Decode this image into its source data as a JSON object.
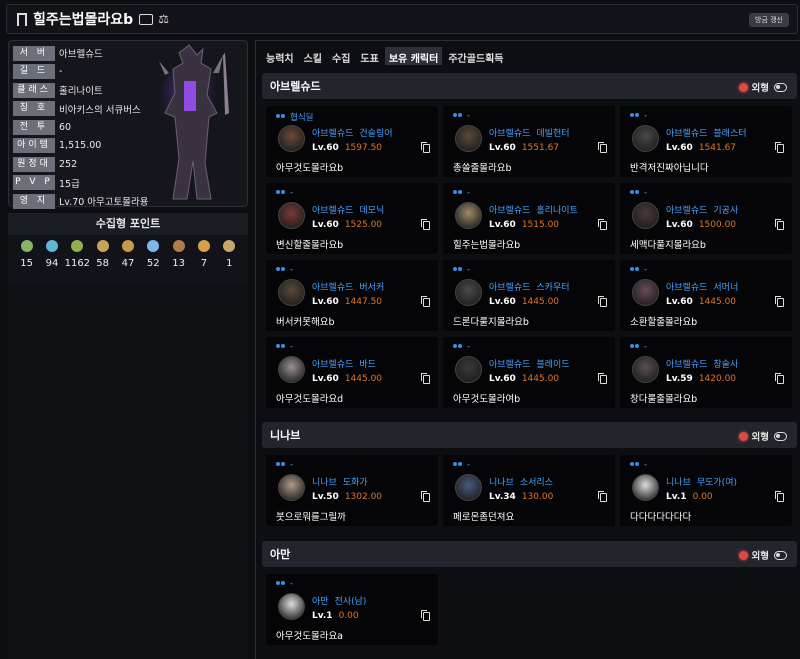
{
  "header": {
    "name": "힐주는법몰라요b",
    "refresh_label": "방금 갱신"
  },
  "profile": {
    "rows": [
      {
        "label": "서 버",
        "value": "아브렐슈드"
      },
      {
        "label": "길 드",
        "value": "-"
      },
      {
        "label": "클래스",
        "value": "홀리나이트"
      },
      {
        "label": "칭 호",
        "value": "비아키스의 서큐버스"
      },
      {
        "label": "전 투",
        "value": "60"
      },
      {
        "label": "아이템",
        "value": "1,515.00"
      },
      {
        "label": "원정대",
        "value": "252"
      },
      {
        "label": "P V P",
        "value": "15급"
      },
      {
        "label": "영 지",
        "value": "Lv.70 아무고토몰라용"
      }
    ]
  },
  "collect": {
    "title": "수집형 포인트",
    "items": [
      {
        "icon": "mokoko-seed-icon",
        "value": "15",
        "color": "#8ab36a"
      },
      {
        "icon": "island-heart-icon",
        "value": "94",
        "color": "#5fb6d6"
      },
      {
        "icon": "giant-heart-icon",
        "value": "1162",
        "color": "#8fb04a"
      },
      {
        "icon": "great-artwork-icon",
        "value": "58",
        "color": "#c7a35a"
      },
      {
        "icon": "voyage-icon",
        "value": "47",
        "color": "#c79a4a"
      },
      {
        "icon": "ignea-token-icon",
        "value": "52",
        "color": "#7fb6e8"
      },
      {
        "icon": "orpheus-star-icon",
        "value": "13",
        "color": "#b07a4a"
      },
      {
        "icon": "omnium-star-icon",
        "value": "7",
        "color": "#d4a04a"
      },
      {
        "icon": "world-tree-leaf-icon",
        "value": "1",
        "color": "#c6a86a"
      }
    ]
  },
  "tabs": [
    {
      "label": "능력치",
      "active": false
    },
    {
      "label": "스킬",
      "active": false
    },
    {
      "label": "수집",
      "active": false
    },
    {
      "label": "도표",
      "active": false
    },
    {
      "label": "보유 캐릭터",
      "active": true
    },
    {
      "label": "주간골드획득",
      "active": false
    }
  ],
  "toggle_label": "외형",
  "sections": [
    {
      "server": "아브렐슈드",
      "cards": [
        {
          "guild": "협식딜",
          "server": "아브렐슈드",
          "class": "건슬링어",
          "level": "Lv.60",
          "ilvl": "1597.50",
          "name": "아무것도몰라요b",
          "avatar": "#6a4a3a"
        },
        {
          "guild": "-",
          "server": "아브렐슈드",
          "class": "데빌헌터",
          "level": "Lv.60",
          "ilvl": "1551.67",
          "name": "총쏠줄몰라요b",
          "avatar": "#5a4a3a"
        },
        {
          "guild": "-",
          "server": "아브렐슈드",
          "class": "블래스터",
          "level": "Lv.60",
          "ilvl": "1541.67",
          "name": "반격저진짜아닙니다",
          "avatar": "#4a4a4a"
        },
        {
          "guild": "-",
          "server": "아브렐슈드",
          "class": "데모닉",
          "level": "Lv.60",
          "ilvl": "1525.00",
          "name": "변신할줄몰라요b",
          "avatar": "#7a3a3a"
        },
        {
          "guild": "-",
          "server": "아브렐슈드",
          "class": "홀리나이트",
          "level": "Lv.60",
          "ilvl": "1515.00",
          "name": "힐주는법몰라요b",
          "avatar": "#a08a6a"
        },
        {
          "guild": "-",
          "server": "아브렐슈드",
          "class": "기공사",
          "level": "Lv.60",
          "ilvl": "1500.00",
          "name": "세맥다풀지몰라요b",
          "avatar": "#4a3a3a"
        },
        {
          "guild": "-",
          "server": "아브렐슈드",
          "class": "버서커",
          "level": "Lv.60",
          "ilvl": "1447.50",
          "name": "버서커못해요b",
          "avatar": "#5a4a3a"
        },
        {
          "guild": "-",
          "server": "아브렐슈드",
          "class": "스카우터",
          "level": "Lv.60",
          "ilvl": "1445.00",
          "name": "드론다룰지몰라요b",
          "avatar": "#4a4a4a"
        },
        {
          "guild": "-",
          "server": "아브렐슈드",
          "class": "서머너",
          "level": "Lv.60",
          "ilvl": "1445.00",
          "name": "소환할줄몰라요b",
          "avatar": "#6a4a5a"
        },
        {
          "guild": "-",
          "server": "아브렐슈드",
          "class": "바드",
          "level": "Lv.60",
          "ilvl": "1445.00",
          "name": "아무것도몰라요d",
          "avatar": "#9a9090"
        },
        {
          "guild": "-",
          "server": "아브렐슈드",
          "class": "블레이드",
          "level": "Lv.60",
          "ilvl": "1445.00",
          "name": "아무것도몰라여b",
          "avatar": "#3a3a3a"
        },
        {
          "guild": "-",
          "server": "아브렐슈드",
          "class": "창술사",
          "level": "Lv.59",
          "ilvl": "1420.00",
          "name": "창다룰줄몰라요b",
          "avatar": "#5a5050"
        }
      ]
    },
    {
      "server": "니나브",
      "cards": [
        {
          "guild": "-",
          "server": "니나브",
          "class": "도화가",
          "level": "Lv.50",
          "ilvl": "1302.00",
          "name": "붓으로뭐를그릴까",
          "avatar": "#b09a8a"
        },
        {
          "guild": "-",
          "server": "니나브",
          "class": "소서리스",
          "level": "Lv.34",
          "ilvl": "130.00",
          "name": "페로몬좀던져요",
          "avatar": "#4a5a7a"
        },
        {
          "guild": "-",
          "server": "니나브",
          "class": "무도가(여)",
          "level": "Lv.1",
          "ilvl": "0.00",
          "name": "다다다다다다다",
          "avatar": "#dddddd"
        }
      ]
    },
    {
      "server": "아만",
      "cards": [
        {
          "guild": "-",
          "server": "아만",
          "class": "전사(남)",
          "level": "Lv.1",
          "ilvl": "0.00",
          "name": "아무것도몰라요a",
          "avatar": "#dddddd"
        }
      ]
    }
  ]
}
